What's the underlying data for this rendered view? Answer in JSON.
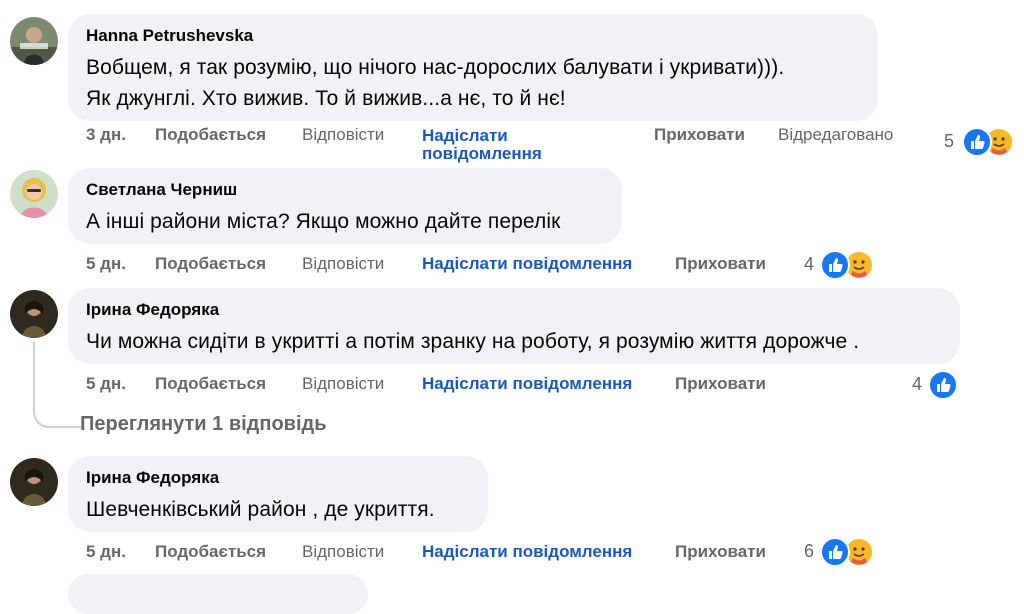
{
  "comments": [
    {
      "author": "Hanna Petrushevska",
      "lines": [
        "Вобщем, я так розумію, що нічого нас-дорослих балувати і укривати))).",
        "Як джунглі. Хто вижив. То й вижив...а нє, то й нє!"
      ],
      "time": "3 дн.",
      "like": "Подобається",
      "reply": "Відповісти",
      "message_line1": "Надіслати",
      "message_line2": "повідомлення",
      "hide": "Приховати",
      "edited": "Відредаговано",
      "reaction_count": "5",
      "reactions": [
        "like-icon",
        "care-icon"
      ]
    },
    {
      "author": "Светлана Черниш",
      "lines": [
        "А інші райони міста? Якщо можно дайте перелік"
      ],
      "time": "5 дн.",
      "like": "Подобається",
      "reply": "Відповісти",
      "message": "Надіслати повідомлення",
      "hide": "Приховати",
      "reaction_count": "4",
      "reactions": [
        "like-icon",
        "care-icon"
      ]
    },
    {
      "author": "Ірина Федоряка",
      "lines": [
        "Чи можна сидіти в укритті а потім зранку на роботу, я розумію життя дорожче ."
      ],
      "time": "5 дн.",
      "like": "Подобається",
      "reply": "Відповісти",
      "message": "Надіслати повідомлення",
      "hide": "Приховати",
      "reaction_count": "4",
      "reactions": [
        "like-icon"
      ],
      "view_replies": "Переглянути 1 відповідь"
    },
    {
      "author": "Ірина Федоряка",
      "lines": [
        "Шевченківський район , де укриття."
      ],
      "time": "5 дн.",
      "like": "Подобається",
      "reply": "Відповісти",
      "message": "Надіслати повідомлення",
      "hide": "Приховати",
      "reaction_count": "6",
      "reactions": [
        "like-icon",
        "care-icon"
      ]
    }
  ],
  "colors": {
    "bubble": "#f0f2f5",
    "action_text": "#65676b",
    "message_link": "#1a5ab8",
    "like_blue": "#1877f2",
    "care_yellow": "#f7b928"
  }
}
